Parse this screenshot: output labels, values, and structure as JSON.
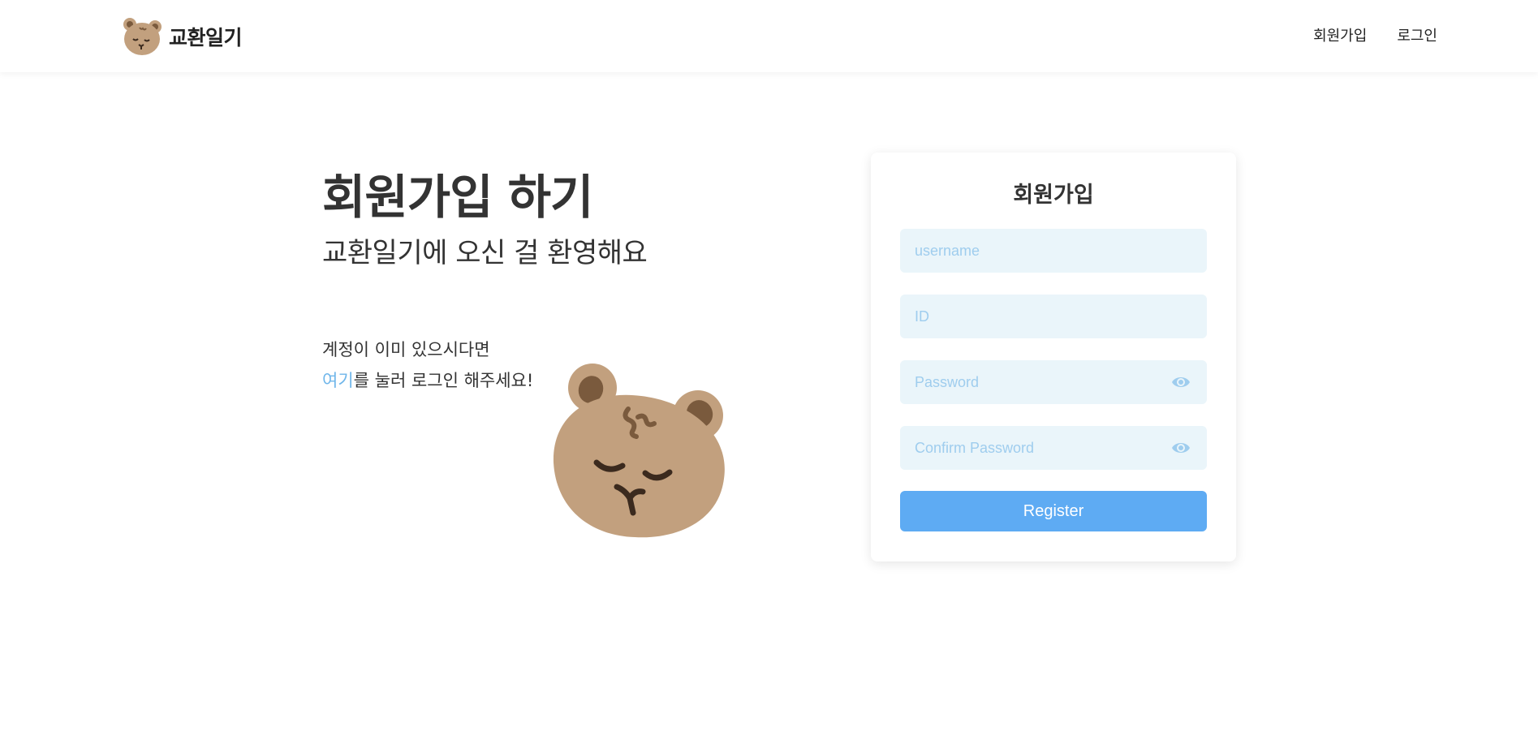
{
  "header": {
    "logo_text": "교환일기",
    "nav": {
      "signup": "회원가입",
      "login": "로그인"
    }
  },
  "hero": {
    "title": "회원가입 하기",
    "subtitle": "교환일기에 오신 걸 환영해요",
    "hint_line1": "계정이 이미 있으시다면",
    "hint_link": "여기",
    "hint_line2_rest": "를 눌러 로그인 해주세요!"
  },
  "form": {
    "title": "회원가입",
    "username_placeholder": "username",
    "id_placeholder": "ID",
    "password_placeholder": "Password",
    "confirm_placeholder": "Confirm Password",
    "submit_label": "Register"
  },
  "colors": {
    "accent": "#5eabf3",
    "link": "#6fb6ea",
    "input_bg": "#eaf5fa",
    "bear": "#c2a07e"
  }
}
